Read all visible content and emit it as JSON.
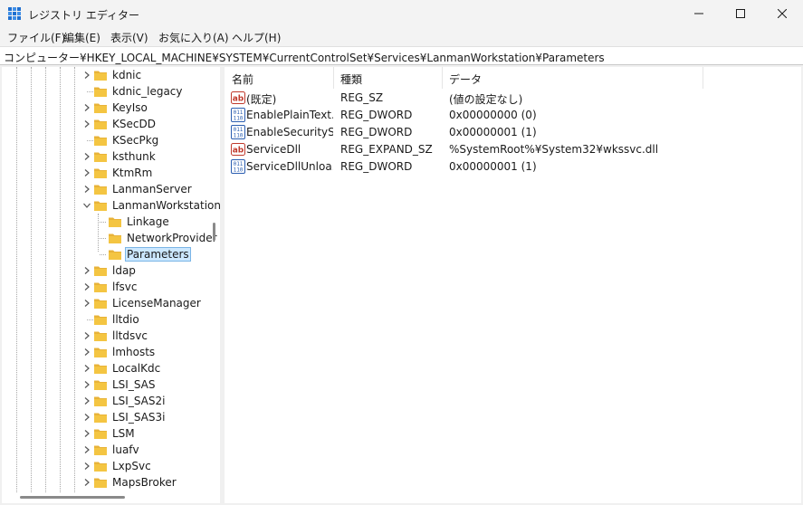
{
  "window": {
    "title": "レジストリ エディター",
    "controls": {
      "minimize": "minimize-icon",
      "maximize": "maximize-icon",
      "close": "close-icon"
    }
  },
  "menu": [
    "ファイル(F)",
    "編集(E)",
    "表示(V)",
    "お気に入り(A)",
    "ヘルプ(H)"
  ],
  "address": "コンピューター¥HKEY_LOCAL_MACHINE¥SYSTEM¥CurrentControlSet¥Services¥LanmanWorkstation¥Parameters",
  "tree": {
    "items": [
      {
        "label": "kdnic",
        "expander": "collapsed",
        "level": 0
      },
      {
        "label": "kdnic_legacy",
        "expander": "none",
        "level": 0
      },
      {
        "label": "KeyIso",
        "expander": "collapsed",
        "level": 0
      },
      {
        "label": "KSecDD",
        "expander": "collapsed",
        "level": 0
      },
      {
        "label": "KSecPkg",
        "expander": "none",
        "level": 0
      },
      {
        "label": "ksthunk",
        "expander": "collapsed",
        "level": 0
      },
      {
        "label": "KtmRm",
        "expander": "collapsed",
        "level": 0
      },
      {
        "label": "LanmanServer",
        "expander": "collapsed",
        "level": 0
      },
      {
        "label": "LanmanWorkstation",
        "expander": "expanded",
        "level": 0
      },
      {
        "label": "Linkage",
        "expander": "none",
        "level": 1
      },
      {
        "label": "NetworkProvider",
        "expander": "none",
        "level": 1
      },
      {
        "label": "Parameters",
        "expander": "none",
        "level": 1,
        "selected": true
      },
      {
        "label": "ldap",
        "expander": "collapsed",
        "level": 0
      },
      {
        "label": "lfsvc",
        "expander": "collapsed",
        "level": 0
      },
      {
        "label": "LicenseManager",
        "expander": "collapsed",
        "level": 0
      },
      {
        "label": "lltdio",
        "expander": "none",
        "level": 0
      },
      {
        "label": "lltdsvc",
        "expander": "collapsed",
        "level": 0
      },
      {
        "label": "lmhosts",
        "expander": "collapsed",
        "level": 0
      },
      {
        "label": "LocalKdc",
        "expander": "collapsed",
        "level": 0
      },
      {
        "label": "LSI_SAS",
        "expander": "collapsed",
        "level": 0
      },
      {
        "label": "LSI_SAS2i",
        "expander": "collapsed",
        "level": 0
      },
      {
        "label": "LSI_SAS3i",
        "expander": "collapsed",
        "level": 0
      },
      {
        "label": "LSM",
        "expander": "collapsed",
        "level": 0
      },
      {
        "label": "luafv",
        "expander": "collapsed",
        "level": 0
      },
      {
        "label": "LxpSvc",
        "expander": "collapsed",
        "level": 0
      },
      {
        "label": "MapsBroker",
        "expander": "collapsed",
        "level": 0
      }
    ]
  },
  "values": {
    "columns": [
      "名前",
      "種類",
      "データ"
    ],
    "rows": [
      {
        "name": "(既定)",
        "type": "REG_SZ",
        "data": "(値の設定なし)",
        "icon": "string-value-icon"
      },
      {
        "name": "EnablePlainText...",
        "type": "REG_DWORD",
        "data": "0x00000000 (0)",
        "icon": "binary-value-icon"
      },
      {
        "name": "EnableSecuritySi...",
        "type": "REG_DWORD",
        "data": "0x00000001 (1)",
        "icon": "binary-value-icon"
      },
      {
        "name": "ServiceDll",
        "type": "REG_EXPAND_SZ",
        "data": "%SystemRoot%¥System32¥wkssvc.dll",
        "icon": "string-value-icon"
      },
      {
        "name": "ServiceDllUnloa...",
        "type": "REG_DWORD",
        "data": "0x00000001 (1)",
        "icon": "binary-value-icon"
      }
    ]
  },
  "colors": {
    "chrome": "#f3f3f3",
    "selection_bg": "#cce8ff",
    "selection_border": "#7ab5e6",
    "folder": "#f4c542",
    "string_icon": "#c0392b",
    "binary_icon": "#2a5db0"
  }
}
